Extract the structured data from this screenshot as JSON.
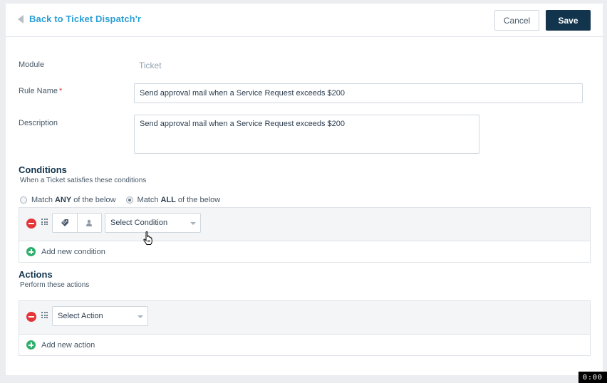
{
  "header": {
    "back_label": "Back to Ticket Dispatch'r",
    "cancel_label": "Cancel",
    "save_label": "Save"
  },
  "form": {
    "module_label": "Module",
    "module_value": "Ticket",
    "rule_name_label": "Rule Name",
    "required_marker": "*",
    "rule_name_value": "Send approval mail when a Service Request exceeds $200",
    "description_label": "Description",
    "description_value": "Send approval mail when a Service Request exceeds $200"
  },
  "conditions": {
    "title": "Conditions",
    "subtitle": "When a Ticket satisfies these conditions",
    "match_prefix": "Match",
    "match_any": "ANY",
    "match_all": "ALL",
    "match_suffix": "of the below",
    "selected_match": "ALL",
    "select_placeholder": "Select Condition",
    "add_label": "Add new condition"
  },
  "actions": {
    "title": "Actions",
    "subtitle": "Perform these actions",
    "select_placeholder": "Select Action",
    "add_label": "Add new action"
  },
  "timer": "0:00",
  "icons": {
    "back": "caret-left-icon",
    "remove": "minus-circle-icon",
    "drag": "drag-handle-icon",
    "ticket": "tag-icon",
    "requester": "user-icon",
    "add": "plus-circle-icon",
    "cursor": "hand-pointer-icon"
  },
  "colors": {
    "link": "#2c9fd6",
    "primary": "#12344d",
    "remove": "#e43538",
    "add": "#2db06b",
    "required": "#d72d30"
  }
}
